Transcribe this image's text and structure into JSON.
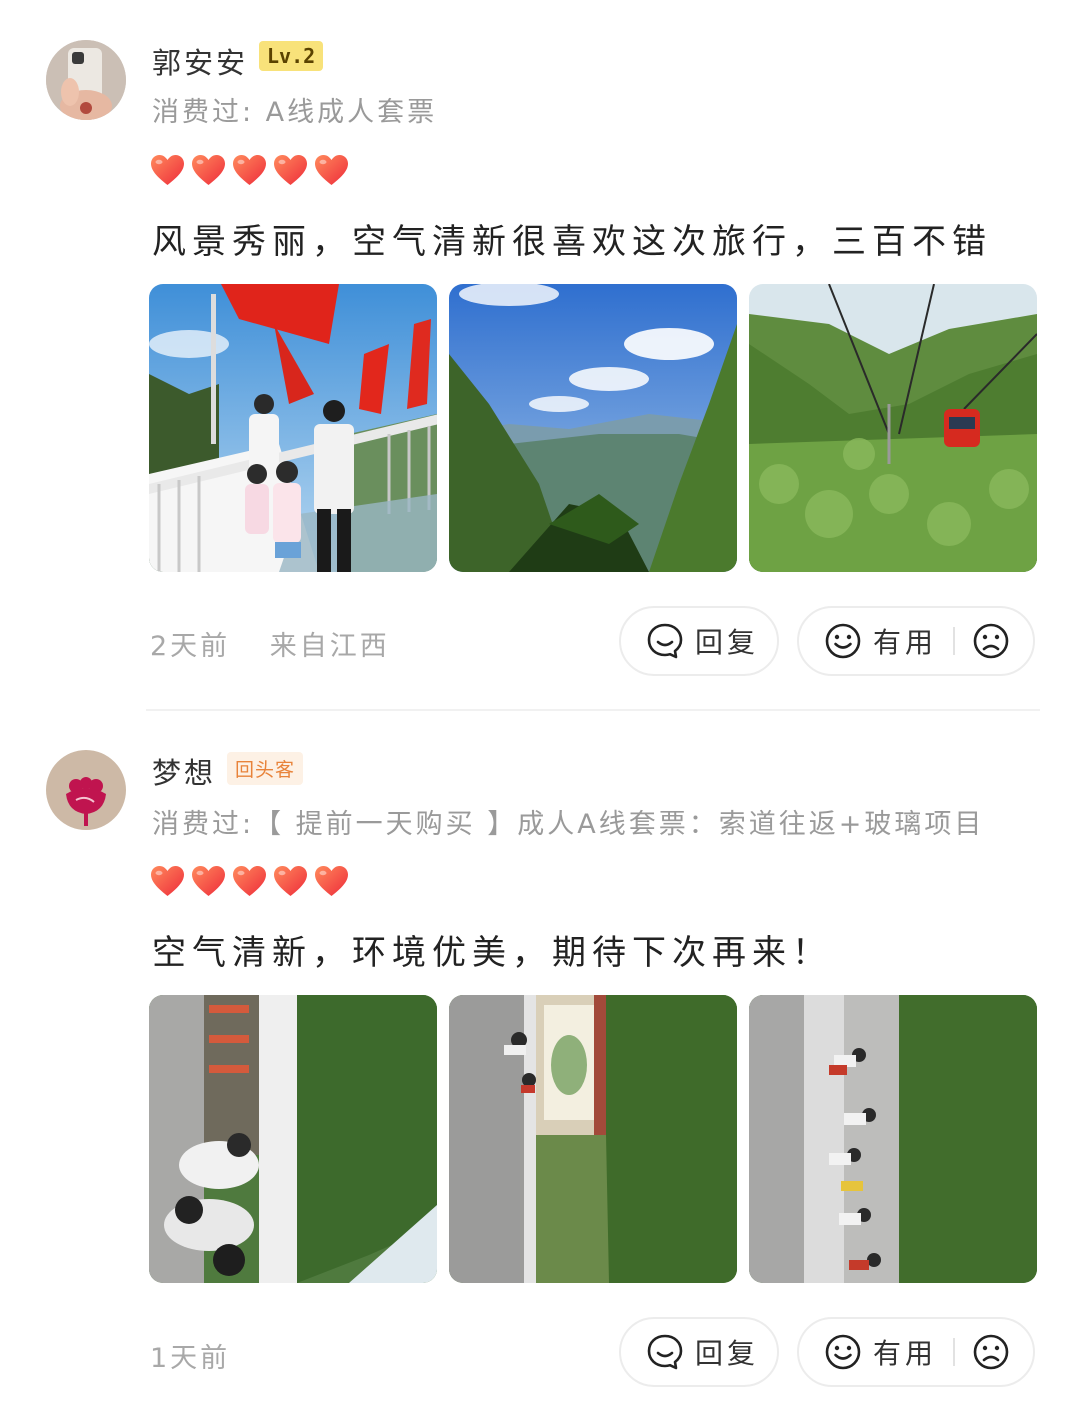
{
  "reviews": [
    {
      "username": "郭安安",
      "badge": "Lv.2",
      "consumed": "消费过: A线成人套票",
      "rating": 5,
      "text": "风景秀丽，空气清新很喜欢这次旅行，三百不错",
      "time": "2天前",
      "location": "来自江西",
      "reply_label": "回复",
      "useful_label": "有用"
    },
    {
      "username": "梦想",
      "badge": "回头客",
      "consumed": "消费过:【 提前一天购买 】成人A线套票：索道往返+玻璃项目",
      "rating": 5,
      "text": "空气清新，环境优美，期待下次再来！",
      "time": "1天前",
      "location": "",
      "reply_label": "回复",
      "useful_label": "有用"
    }
  ],
  "colors": {
    "heart": "#f0443c",
    "level_badge_bg": "#f8e27a",
    "return_badge_text": "#e8833a",
    "muted_text": "#9a9a9a"
  },
  "icons": {
    "reply": "speech-bubble-icon",
    "useful": "smile-face-icon",
    "not_useful": "sad-face-icon",
    "rating": "heart-icon"
  }
}
